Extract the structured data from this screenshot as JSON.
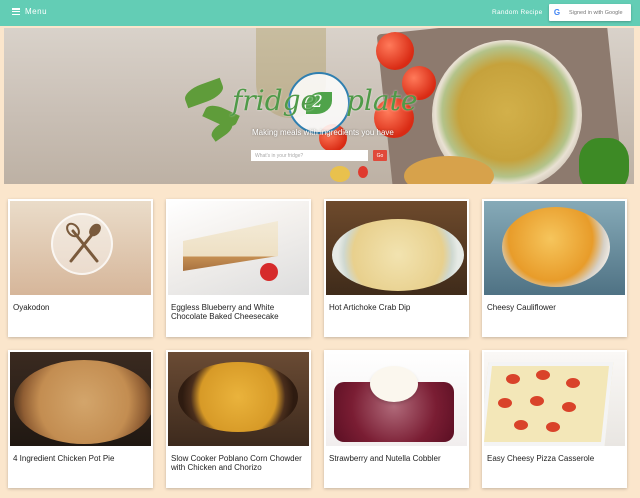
{
  "topbar": {
    "menu_label": "Menu",
    "random_recipe_label": "Random Recipe",
    "google_label": "Signed in with Google",
    "colors": {
      "bar": "#63cdb5",
      "text": "#ffffff"
    }
  },
  "hero": {
    "logo_word_1": "fridge",
    "logo_number": "2",
    "logo_word_2": "plate",
    "tagline": "Making meals with ingredients you have",
    "search_placeholder": "What's in your fridge?",
    "go_label": "Go",
    "colors": {
      "logo_green": "#4f9a48",
      "go_button": "#e04a3b"
    }
  },
  "recipes": [
    {
      "title": "Oyakodon",
      "image": "utensils-placeholder"
    },
    {
      "title": "Eggless Blueberry and White Chocolate Baked Cheesecake",
      "image": "cheesecake-photo"
    },
    {
      "title": "Hot Artichoke Crab Dip",
      "image": "dip-photo"
    },
    {
      "title": "Cheesy Cauliflower",
      "image": "cauliflower-photo"
    },
    {
      "title": "4 Ingredient Chicken Pot Pie",
      "image": "potpie-photo"
    },
    {
      "title": "Slow Cooker Poblano Corn Chowder with Chicken and Chorizo",
      "image": "chowder-photo"
    },
    {
      "title": "Strawberry and Nutella Cobbler",
      "image": "cobbler-photo"
    },
    {
      "title": "Easy Cheesy Pizza Casserole",
      "image": "pizza-casserole-photo"
    }
  ],
  "colors": {
    "page_background": "#fbe6cc",
    "card_background": "#ffffff"
  }
}
